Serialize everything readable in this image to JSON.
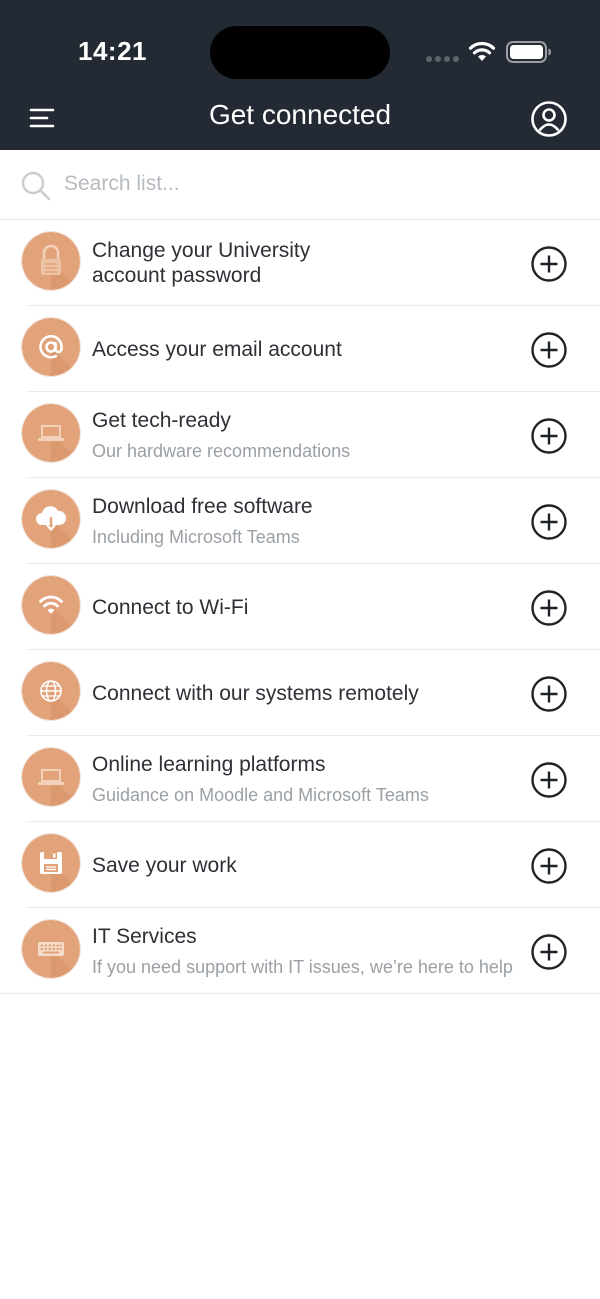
{
  "status_bar": {
    "time": "14:21"
  },
  "nav": {
    "title": "Get connected",
    "menu_icon": "hamburger-menu-icon",
    "profile_icon": "user-profile-icon"
  },
  "search": {
    "placeholder": "Search list...",
    "value": ""
  },
  "theme": {
    "header_bg": "#232a33",
    "icon_orange": "#e2a37b",
    "text_primary": "#2d3136",
    "text_secondary": "#9aa0a5"
  },
  "items": [
    {
      "title": "Change your University account password",
      "subtitle": "",
      "icon": "padlock-icon"
    },
    {
      "title": "Access your email account",
      "subtitle": "",
      "icon": "at-sign-icon"
    },
    {
      "title": "Get tech-ready",
      "subtitle": "Our hardware recommendations",
      "icon": "laptop-icon"
    },
    {
      "title": "Download free software",
      "subtitle": "Including Microsoft Teams",
      "icon": "cloud-download-icon"
    },
    {
      "title": "Connect to Wi-Fi",
      "subtitle": "",
      "icon": "wifi-icon"
    },
    {
      "title": "Connect with our systems remotely",
      "subtitle": "",
      "icon": "globe-icon"
    },
    {
      "title": "Online learning platforms",
      "subtitle": "Guidance on Moodle and Microsoft Teams",
      "icon": "laptop-icon"
    },
    {
      "title": "Save your work",
      "subtitle": "",
      "icon": "floppy-disk-icon"
    },
    {
      "title": "IT Services",
      "subtitle": "If you need support with IT issues, we’re here to help",
      "icon": "keyboard-icon"
    }
  ]
}
